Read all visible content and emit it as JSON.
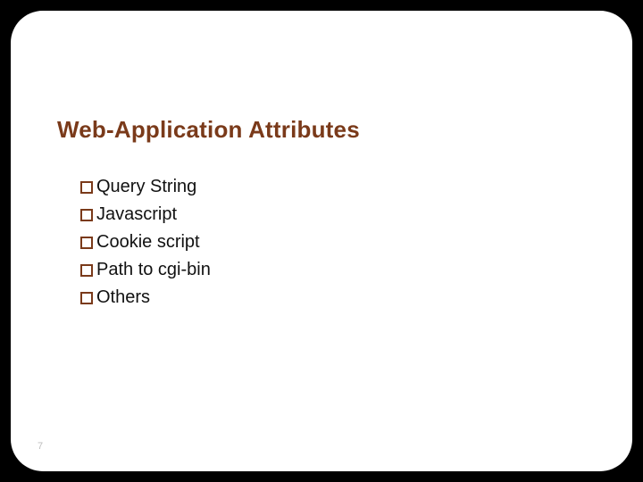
{
  "title": "Web-Application Attributes",
  "items": [
    "Query String",
    "Javascript",
    "Cookie script",
    "Path to cgi-bin",
    "Others"
  ],
  "page_number": "7"
}
